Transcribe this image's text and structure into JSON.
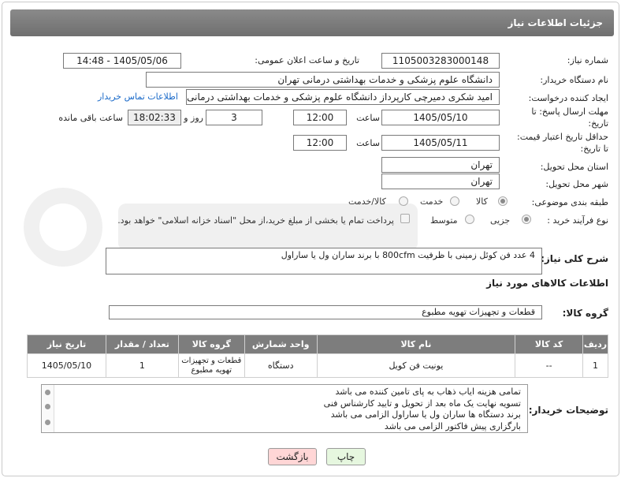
{
  "header": {
    "title": "جزئیات اطلاعات نیاز"
  },
  "fields": {
    "need_number": {
      "label": "شماره نیاز:",
      "value": "1105003283000148"
    },
    "announce": {
      "label": "تاریخ و ساعت اعلان عمومی:",
      "value": "1405/05/06 - 14:48"
    },
    "buyer_org": {
      "label": "نام دستگاه خریدار:",
      "value": "دانشگاه علوم پزشکی و خدمات بهداشتی درمانی تهران"
    },
    "requester": {
      "label": "ایجاد کننده درخواست:",
      "value": "امید شکری دمیرچی کارپرداز دانشگاه علوم پزشکی و خدمات بهداشتی درمانی",
      "contact_link": "اطلاعات تماس خریدار"
    },
    "deadline": {
      "label_line1": "مهلت ارسال پاسخ: تا",
      "label_line2": "تاریخ:",
      "date": "1405/05/10",
      "time_label": "ساعت",
      "time": "12:00",
      "days": "3",
      "days_label": "روز و",
      "remaining": "18:02:33",
      "remaining_label": "ساعت باقی مانده"
    },
    "price_validity": {
      "label_line1": "حداقل تاریخ اعتبار قیمت:",
      "label_line2": "تا تاریخ:",
      "date": "1405/05/11",
      "time_label": "ساعت",
      "time": "12:00"
    },
    "province": {
      "label": "استان محل تحویل:",
      "value": "تهران"
    },
    "city": {
      "label": "شهر محل تحویل:",
      "value": "تهران"
    },
    "category": {
      "label": "طبقه بندی موضوعی:",
      "options": [
        "کالا",
        "خدمت",
        "کالا/خدمت"
      ],
      "selected": "کالا"
    },
    "process": {
      "label": "نوع فرآیند خرید :",
      "options": [
        "جزیی",
        "متوسط"
      ],
      "selected": "جزیی",
      "payment_note": "پرداخت تمام یا بخشی از مبلغ خرید،از محل \"اسناد خزانه اسلامی\" خواهد بود."
    }
  },
  "description": {
    "label": "شرح کلی نیاز:",
    "value": "4 عدد فن کوئل زمینی با ظرفیت 800cfm با برند ساران ول یا ساراول"
  },
  "goods_info": {
    "title": "اطلاعات کالاهای مورد نیاز"
  },
  "goods_group": {
    "label": "گروه کالا:",
    "value": "قطعات و تجهیزات تهویه مطبوع"
  },
  "table": {
    "headers": [
      "ردیف",
      "کد کالا",
      "نام کالا",
      "واحد شمارش",
      "گروه کالا",
      "تعداد / مقدار",
      "تاریخ نیاز"
    ],
    "rows": [
      {
        "row": "1",
        "code": "--",
        "name": "یونیت فن کویل",
        "unit": "دستگاه",
        "group": "قطعات و تجهیزات تهویه مطبوع",
        "qty": "1",
        "date": "1405/05/10"
      }
    ]
  },
  "buyer_notes": {
    "label": "توضیحات خریدار:",
    "lines": [
      "تمامی هزینه ایاب ذهاب به پای تامین کننده می باشد",
      "تسویه نهایت یک ماه بعد از تحویل و تایید کارشناس فنی",
      "برند دستگاه ها ساران ول یا ساراول الزامی می باشد",
      "بارگزاری پیش فاکتور الزامی می باشد"
    ]
  },
  "buttons": {
    "print": "چاپ",
    "back": "بازگشت"
  },
  "colors": {
    "header_bg": "#7a7a7a",
    "link": "#1a6ac9",
    "back_bg": "#ffd6d6",
    "print_bg": "#e6f7df"
  }
}
